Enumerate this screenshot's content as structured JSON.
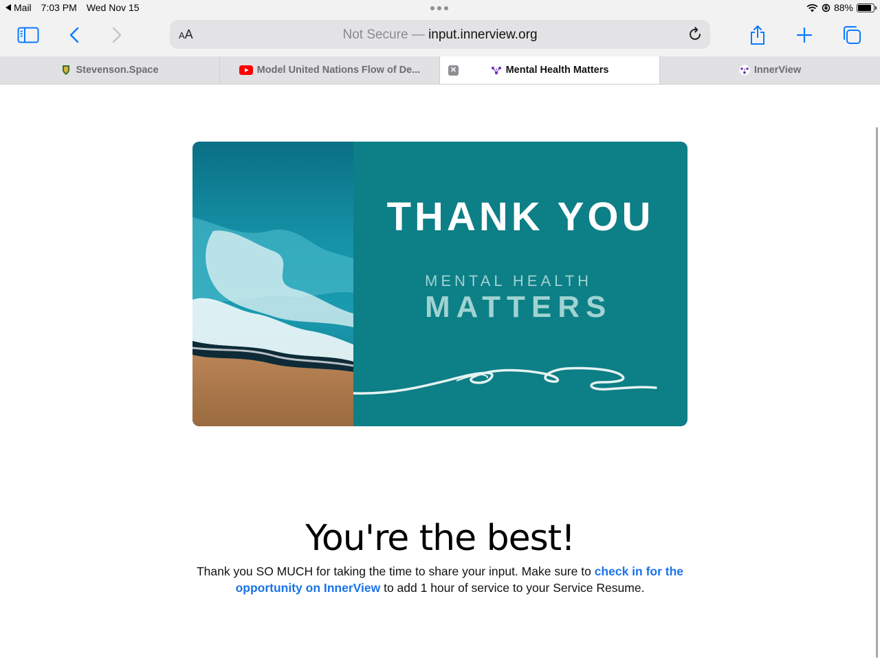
{
  "status_bar": {
    "back_app": "Mail",
    "time": "7:03 PM",
    "date": "Wed Nov 15",
    "battery": "88%",
    "battery_level": 0.88
  },
  "toolbar": {
    "text_size_label_small": "A",
    "text_size_label_large": "A",
    "url_prefix": "Not Secure —",
    "url_host": "input.innerview.org"
  },
  "tabs": [
    {
      "title": "Stevenson.Space",
      "icon": "stevenson-shield-icon",
      "active": false
    },
    {
      "title": "Model United Nations Flow of De...",
      "icon": "youtube-icon",
      "active": false
    },
    {
      "title": "Mental Health Matters",
      "icon": "innerview-icon",
      "active": true
    },
    {
      "title": "InnerView",
      "icon": "innerview-icon",
      "active": false
    }
  ],
  "card": {
    "title": "THANK YOU",
    "subtitle_line1": "MENTAL  HEALTH",
    "subtitle_line2": "MATTERS",
    "colors": {
      "teal": "#0d7f86",
      "subtitle": "#9fd3d2"
    }
  },
  "content": {
    "heading": "You're the best!",
    "message_part1": "Thank you SO MUCH for taking the time to share your input. Make sure to ",
    "message_link": "check in for the opportunity on InnerView",
    "message_part2": " to add 1 hour of service to your Service Resume."
  },
  "colors": {
    "link": "#1a73e8",
    "ios_blue": "#0a7aff"
  }
}
